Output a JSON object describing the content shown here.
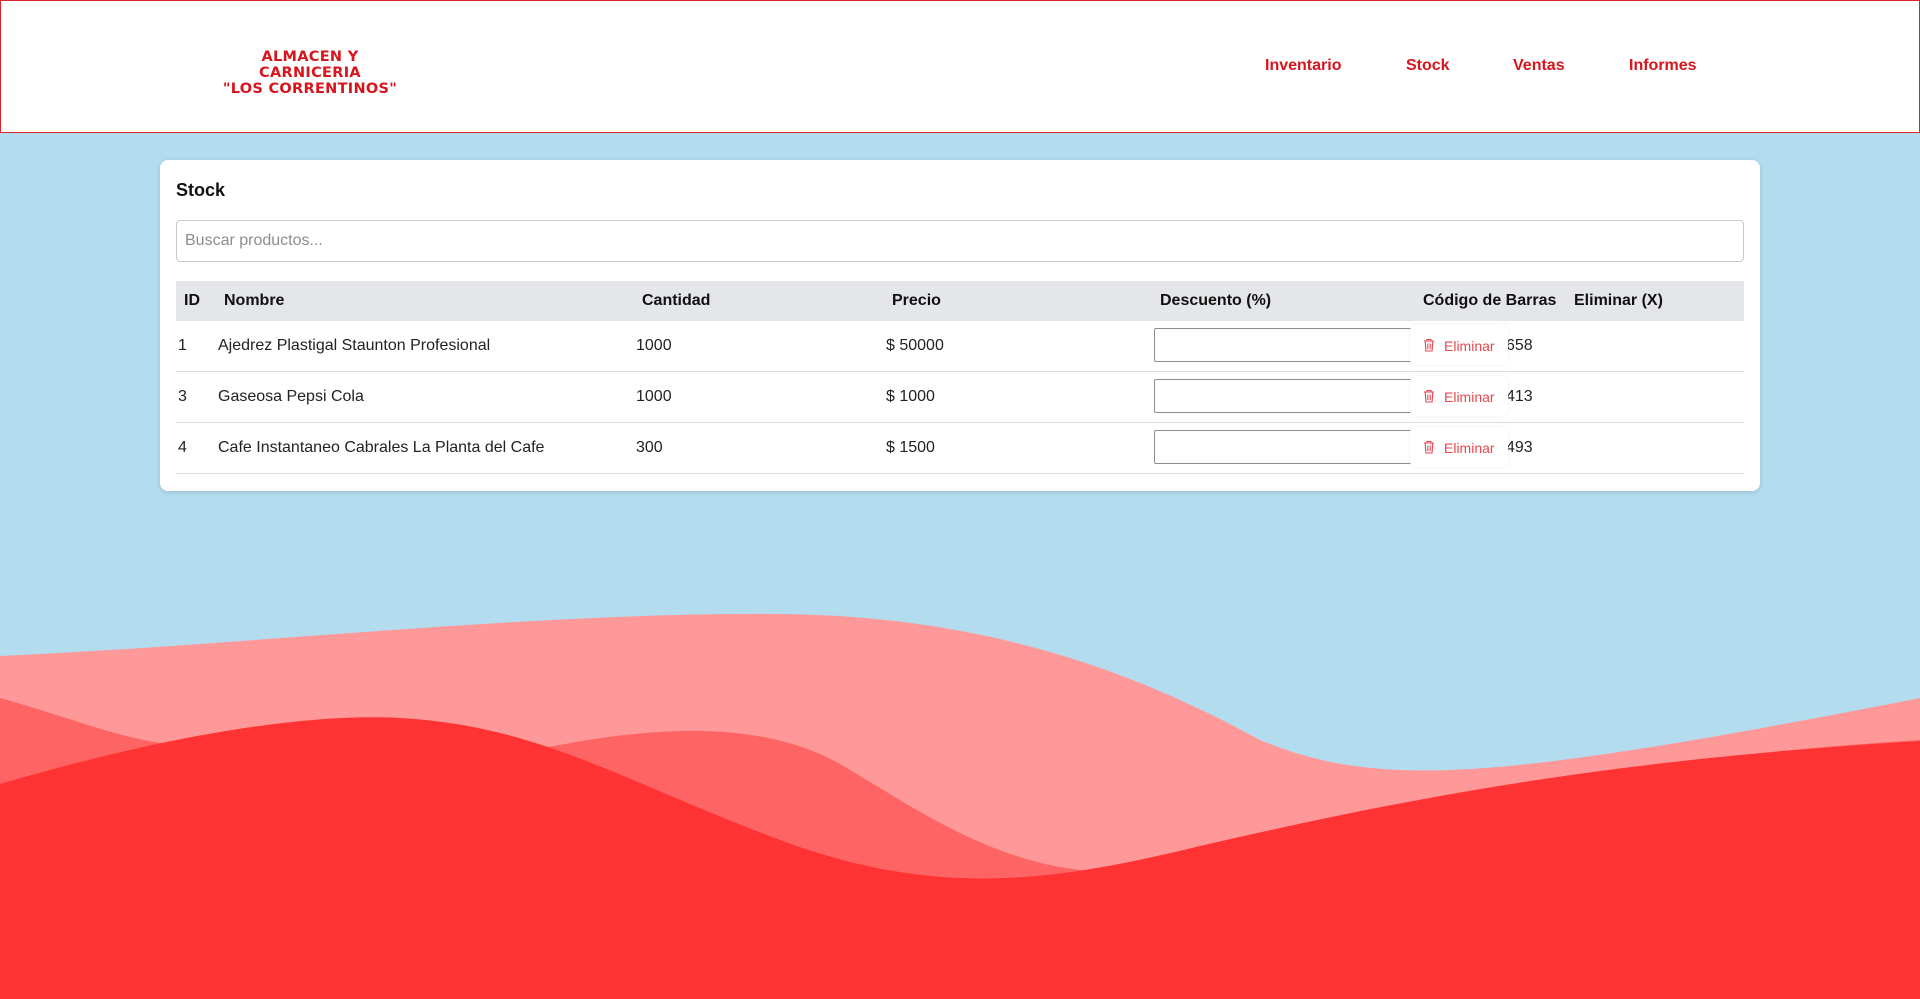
{
  "header": {
    "logo_line1": "ALMACEN Y CARNICERIA",
    "logo_line2": "\"LOS CORRENTINOS\"",
    "nav": [
      "Inventario",
      "Stock",
      "Ventas",
      "Informes"
    ]
  },
  "stock": {
    "title": "Stock",
    "search_placeholder": "Buscar productos...",
    "columns": [
      "ID",
      "Nombre",
      "Cantidad",
      "Precio",
      "Descuento (%)",
      "Código de Barras",
      "Eliminar (X)"
    ],
    "delete_label": "Eliminar",
    "rows": [
      {
        "id": "1",
        "nombre": "Ajedrez Plastigal Staunton Profesional",
        "cantidad": "1000",
        "precio": "$ 50000",
        "descuento": "",
        "codigo": "7796133001658"
      },
      {
        "id": "3",
        "nombre": "Gaseosa Pepsi Cola",
        "cantidad": "1000",
        "precio": "$ 1000",
        "descuento": "",
        "codigo": "7791813888413"
      },
      {
        "id": "4",
        "nombre": "Cafe Instantaneo Cabrales La Planta del Cafe",
        "cantidad": "300",
        "precio": "$ 1500",
        "descuento": "",
        "codigo": "7790550029493"
      }
    ]
  },
  "colors": {
    "brand_red": "#d6151d",
    "background_blue": "#b3dcef",
    "wave_light": "#ff9898",
    "wave_mid": "#ff6464",
    "wave_dark": "#ff3333"
  }
}
